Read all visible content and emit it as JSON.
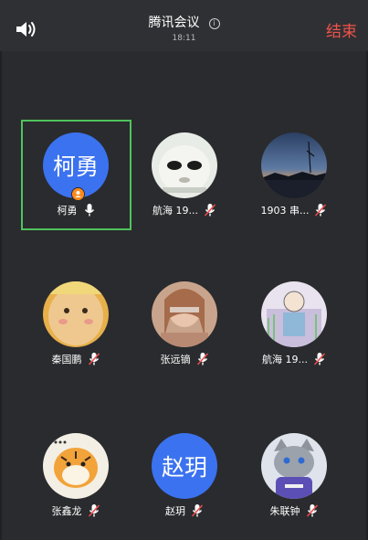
{
  "header": {
    "title": "腾讯会议",
    "info_icon_glyph": "i",
    "time": "18:11",
    "end_label": "结束",
    "speaker_icon": "speaker-icon"
  },
  "participants": [
    {
      "name": "柯勇",
      "avatar_text": "柯勇",
      "avatar_type": "initials",
      "mic": "on",
      "host": true,
      "active": true
    },
    {
      "name": "航海 19...",
      "avatar_type": "photo",
      "avatar_desc": "cartoon face",
      "mic": "muted"
    },
    {
      "name": "1903 串...",
      "avatar_type": "photo",
      "avatar_desc": "sunset lake",
      "mic": "muted"
    },
    {
      "name": "秦国鹏",
      "avatar_type": "photo",
      "avatar_desc": "cartoon character",
      "mic": "muted"
    },
    {
      "name": "张远镝",
      "avatar_type": "photo",
      "avatar_desc": "portrait",
      "mic": "muted"
    },
    {
      "name": "航海 19...",
      "avatar_type": "photo",
      "avatar_desc": "drawing",
      "mic": "muted"
    },
    {
      "name": "张鑫龙",
      "avatar_type": "photo",
      "avatar_desc": "cartoon tiger",
      "mic": "muted"
    },
    {
      "name": "赵玥",
      "avatar_text": "赵玥",
      "avatar_type": "initials",
      "mic": "muted"
    },
    {
      "name": "朱联钟",
      "avatar_type": "photo",
      "avatar_desc": "cartoon cat",
      "mic": "muted"
    }
  ],
  "colors": {
    "background": "#2a2b2e",
    "header": "#2f3033",
    "end": "#f0534a",
    "active_border": "#4fc35d",
    "avatar_blue": "#3b72f0",
    "muted_red": "#e94b4b",
    "host_badge": "#ff8a1c"
  }
}
